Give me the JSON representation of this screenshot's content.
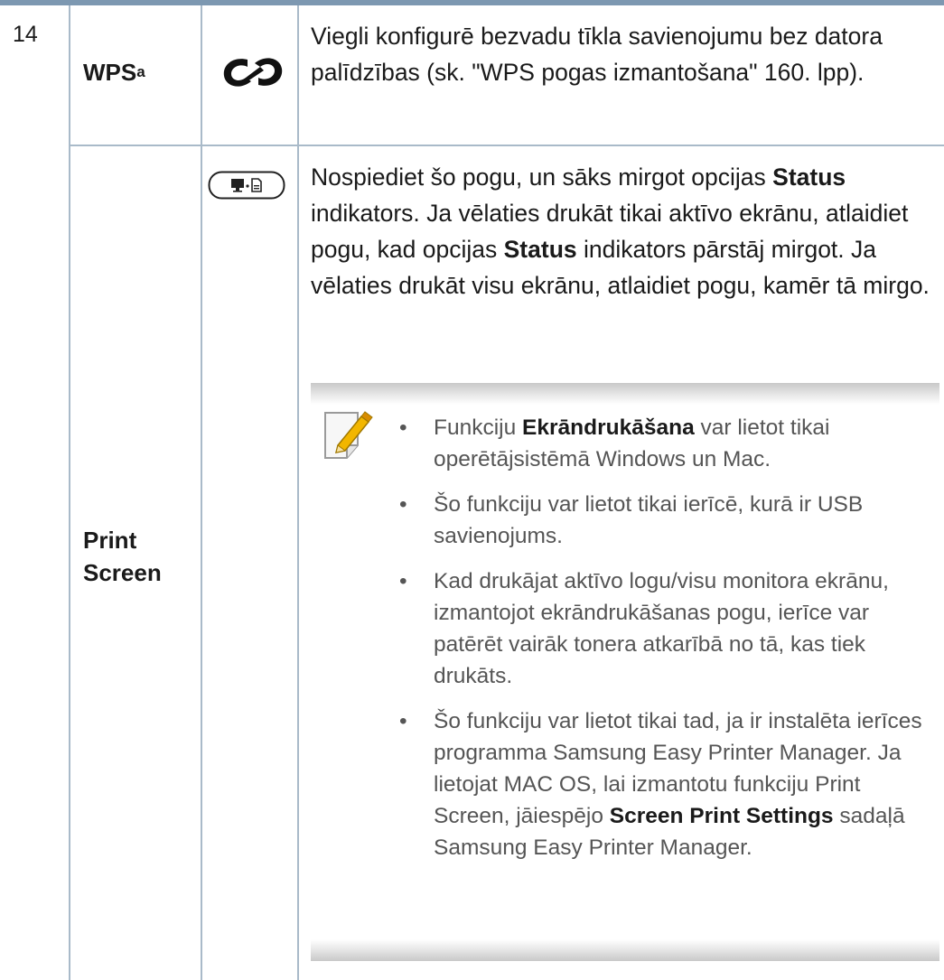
{
  "row_number": "14",
  "wps": {
    "label": "WPS",
    "footnote": "a",
    "icon": "wps-icon",
    "description": "Viegli konfigurē bezvadu tīkla savienojumu bez datora palīdzības (sk. \"WPS pogas izmantošana\" 160. lpp)."
  },
  "print_screen": {
    "label": "Print Screen",
    "icon": "print-screen-button-icon",
    "icon_glyph": "▀·🗎",
    "description_parts": [
      {
        "text": "Nospiediet šo pogu, un sāks mirgot opcijas "
      },
      {
        "text": "Status",
        "bold": true
      },
      {
        "text": " indikators. Ja vēlaties drukāt tikai aktīvo ekrānu, atlaidiet pogu, kad opcijas "
      },
      {
        "text": "Status",
        "bold": true
      },
      {
        "text": " indikators pārstāj mirgot. Ja vēlaties drukāt visu ekrānu, atlaidiet pogu, kamēr tā mirgo."
      }
    ],
    "note": {
      "icon": "note-pencil-icon",
      "bullet_char": "•",
      "bullets": [
        [
          {
            "text": "Funkciju "
          },
          {
            "text": "Ekrāndrukāšana",
            "bold": true
          },
          {
            "text": " var lietot tikai operētājsistēmā Windows un Mac."
          }
        ],
        [
          {
            "text": "Šo funkciju var lietot tikai ierīcē, kurā ir USB savienojums."
          }
        ],
        [
          {
            "text": "Kad drukājat aktīvo logu/visu monitora ekrānu, izmantojot ekrāndrukāšanas pogu, ierīce var patērēt vairāk tonera atkarībā no tā, kas tiek drukāts."
          }
        ],
        [
          {
            "text": "Šo funkciju var lietot tikai tad, ja ir instalēta ierīces programma Samsung Easy Printer Manager. Ja lietojat MAC OS, lai izmantotu funkciju Print Screen, jāiespējo "
          },
          {
            "text": "Screen Print Settings",
            "bold": true
          },
          {
            "text": " sadaļā Samsung Easy Printer Manager."
          }
        ]
      ]
    }
  },
  "colors": {
    "top_rule": "#7d98b1",
    "grid_lines": "#a9bac9",
    "note_text": "#555555"
  }
}
